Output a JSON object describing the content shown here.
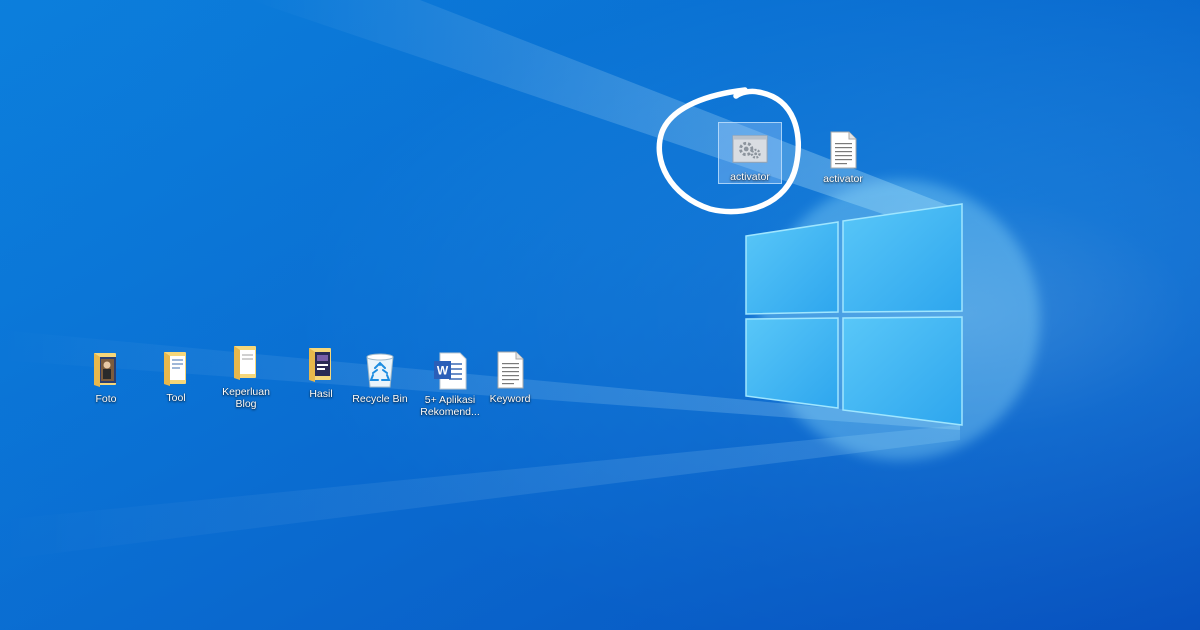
{
  "desktop": {
    "wallpaper": {
      "base_color": "#0a78d7",
      "light_color": "#6fd0ff",
      "dark_color": "#0b57c6",
      "logo_pane_color": "#4ec3f7"
    },
    "icons": [
      {
        "id": "foto",
        "label": "Foto",
        "icon": "folder-photo-icon"
      },
      {
        "id": "tool",
        "label": "Tool",
        "icon": "folder-icon"
      },
      {
        "id": "keperluan-blog",
        "label": "Keperluan Blog",
        "icon": "folder-icon"
      },
      {
        "id": "hasil",
        "label": "Hasil",
        "icon": "folder-document-icon"
      },
      {
        "id": "recycle-bin",
        "label": "Recycle Bin",
        "icon": "recycle-bin-icon"
      },
      {
        "id": "aplikasi",
        "label": "5+ Aplikasi Rekomend...",
        "icon": "word-document-icon"
      },
      {
        "id": "keyword",
        "label": "Keyword",
        "icon": "text-file-icon"
      },
      {
        "id": "activator-cmd",
        "label": "activator",
        "icon": "batch-file-icon",
        "selected": true
      },
      {
        "id": "activator-txt",
        "label": "activator",
        "icon": "text-file-icon"
      }
    ]
  },
  "annotation": {
    "shape": "hand-drawn circle",
    "color": "#ffffff"
  }
}
